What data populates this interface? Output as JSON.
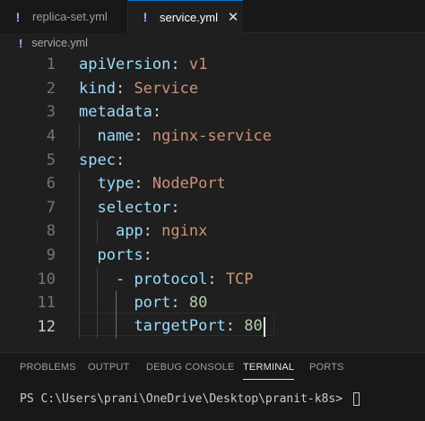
{
  "tabs": [
    {
      "icon": "!",
      "label": "replica-set.yml",
      "active": false
    },
    {
      "icon": "!",
      "label": "service.yml",
      "active": true,
      "close": "✕"
    }
  ],
  "breadcrumb": {
    "icon": "!",
    "file": "service.yml"
  },
  "editor": {
    "current_line": 12,
    "lines": [
      {
        "n": "1",
        "k": "apiVersion",
        "c": ": ",
        "v": "v1",
        "t": "val"
      },
      {
        "n": "2",
        "k": "kind",
        "c": ": ",
        "v": "Service",
        "t": "val"
      },
      {
        "n": "3",
        "k": "metadata",
        "c": ":",
        "v": "",
        "t": "val"
      },
      {
        "n": "4",
        "k": "name",
        "c": ": ",
        "v": "nginx-service",
        "t": "val"
      },
      {
        "n": "5",
        "k": "spec",
        "c": ":",
        "v": "",
        "t": "val"
      },
      {
        "n": "6",
        "k": "type",
        "c": ": ",
        "v": "NodePort",
        "t": "val"
      },
      {
        "n": "7",
        "k": "selector",
        "c": ":",
        "v": "",
        "t": "val"
      },
      {
        "n": "8",
        "k": "app",
        "c": ": ",
        "v": "nginx",
        "t": "val"
      },
      {
        "n": "9",
        "k": "ports",
        "c": ":",
        "v": "",
        "t": "val"
      },
      {
        "n": "10",
        "dash": "- ",
        "k": "protocol",
        "c": ": ",
        "v": "TCP",
        "t": "val"
      },
      {
        "n": "11",
        "k": "port",
        "c": ": ",
        "v": "80",
        "t": "num"
      },
      {
        "n": "12",
        "k": "targetPort",
        "c": ": ",
        "v": "80",
        "t": "num"
      }
    ]
  },
  "panel": {
    "tabs": [
      "PROBLEMS",
      "OUTPUT",
      "DEBUG CONSOLE",
      "TERMINAL",
      "PORTS"
    ],
    "active_tab": "TERMINAL",
    "terminal_prompt": "PS C:\\Users\\prani\\OneDrive\\Desktop\\pranit-k8s> "
  }
}
